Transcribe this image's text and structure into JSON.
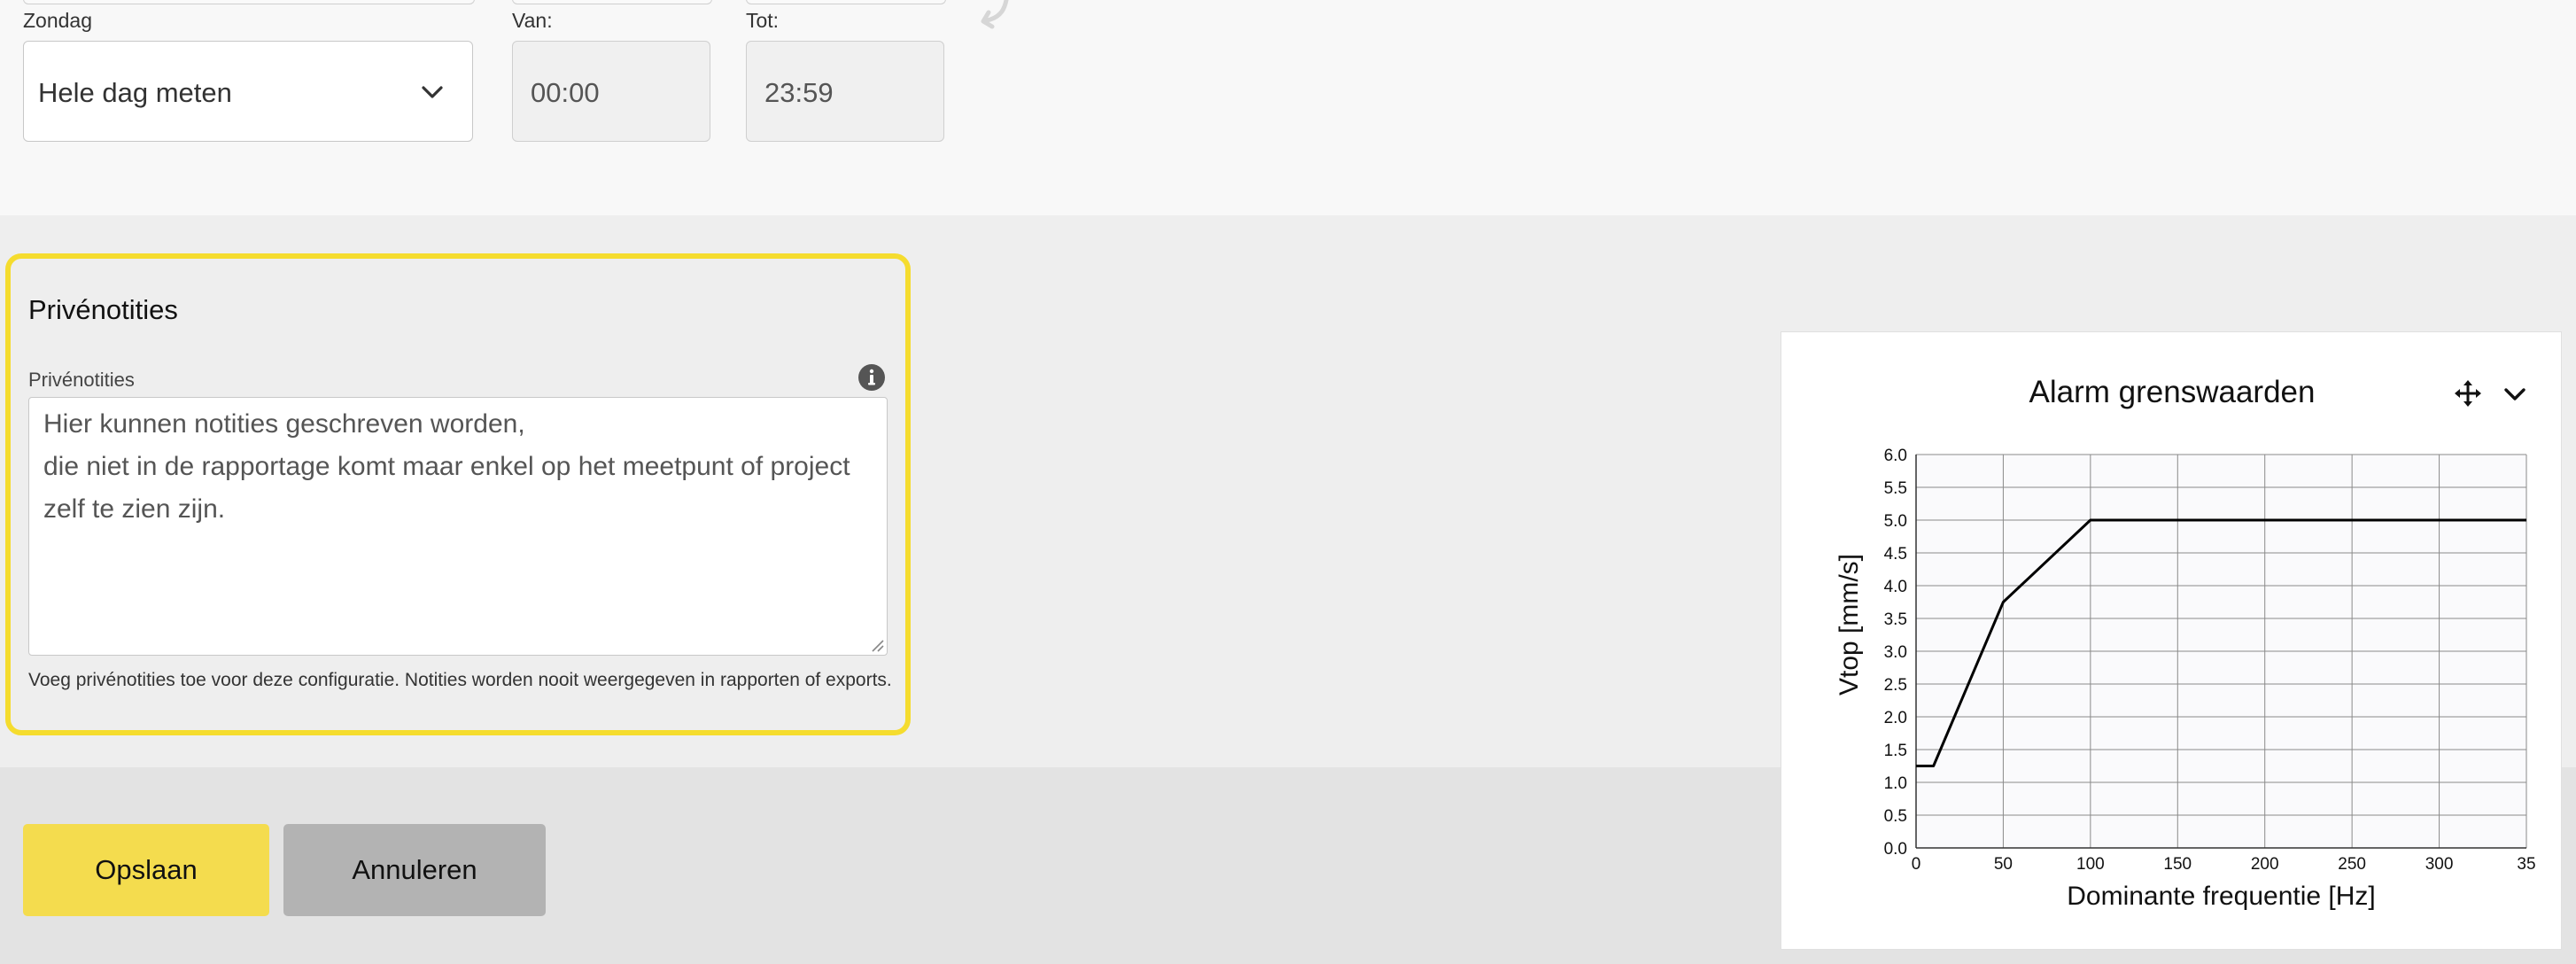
{
  "schedule": {
    "day_label": "Zondag",
    "mode_value": "Hele dag meten",
    "from_label": "Van:",
    "from_value": "00:00",
    "to_label": "Tot:",
    "to_value": "23:59"
  },
  "notes": {
    "title": "Privénotities",
    "field_label": "Privénotities",
    "lines": [
      "Hier kunnen notities geschreven worden,",
      "die niet in de rapportage komt maar enkel op het meetpunt of project",
      "zelf te zien zijn."
    ],
    "help_text": "Voeg privénotities toe voor deze configuratie. Notities worden nooit weergegeven in rapporten of exports."
  },
  "buttons": {
    "save_label": "Opslaan",
    "cancel_label": "Annuleren"
  },
  "colors": {
    "accent_yellow": "#f5dc2e",
    "save_button": "#f4dc4e",
    "cancel_button": "#b3b3b3"
  },
  "icons": {
    "select": "chevron-down-icon",
    "info": "info-icon",
    "chart_move": "move-icon",
    "chart_menu": "chevron-down-icon"
  },
  "chart_data": {
    "type": "line",
    "title": "Alarm grenswaarden",
    "xlabel": "Dominante frequentie [Hz]",
    "ylabel": "Vtop [mm/s]",
    "xlim": [
      0,
      350
    ],
    "ylim": [
      0,
      6
    ],
    "x_ticks": [
      "0",
      "50",
      "100",
      "150",
      "200",
      "250",
      "300",
      "35"
    ],
    "y_ticks": [
      "0.0",
      "0.5",
      "1.0",
      "1.5",
      "2.0",
      "2.5",
      "3.0",
      "3.5",
      "4.0",
      "4.5",
      "5.0",
      "5.5",
      "6.0"
    ],
    "grid": true,
    "series": [
      {
        "x": [
          0,
          10,
          50,
          100,
          350
        ],
        "y": [
          1.25,
          1.25,
          3.75,
          5.0,
          5.0
        ]
      }
    ]
  }
}
